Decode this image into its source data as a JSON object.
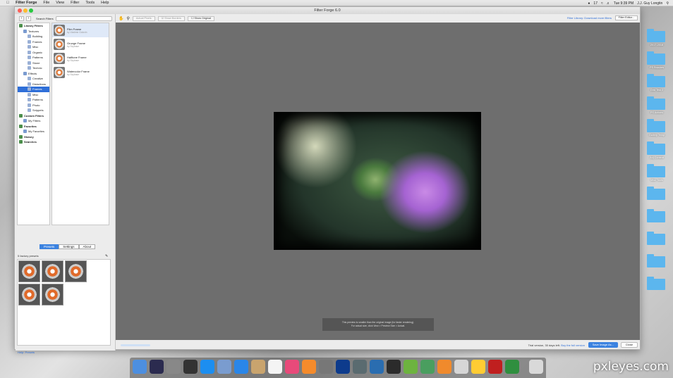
{
  "menubar": {
    "apple": "",
    "app_name": "Filter Forge",
    "items": [
      "File",
      "View",
      "Filter",
      "Tools",
      "Help"
    ],
    "time": "Tue 9:39 PM",
    "user": "J.J. Guy Longtin",
    "battery_badge": "17"
  },
  "window": {
    "title": "Filter Forge 6.0",
    "search_label": "Search Filters"
  },
  "tree": [
    {
      "label": "Library Filters",
      "level": 0,
      "bold": true
    },
    {
      "label": "Textures",
      "level": 1
    },
    {
      "label": "Building",
      "level": 2
    },
    {
      "label": "Frames",
      "level": 2
    },
    {
      "label": "Misc",
      "level": 2
    },
    {
      "label": "Organic",
      "level": 2
    },
    {
      "label": "Patterns",
      "level": 2
    },
    {
      "label": "Stone",
      "level": 2
    },
    {
      "label": "Technic",
      "level": 2
    },
    {
      "label": "Effects",
      "level": 1
    },
    {
      "label": "Creative",
      "level": 2
    },
    {
      "label": "Distortions",
      "level": 2
    },
    {
      "label": "Frames",
      "level": 2,
      "selected": true
    },
    {
      "label": "Misc",
      "level": 2
    },
    {
      "label": "Patterns",
      "level": 2
    },
    {
      "label": "Photo",
      "level": 2
    },
    {
      "label": "Snippets",
      "level": 2
    },
    {
      "label": "Custom Filters",
      "level": 0,
      "bold": true
    },
    {
      "label": "My Filters",
      "level": 1
    },
    {
      "label": "Favorites",
      "level": 0,
      "bold": true
    },
    {
      "label": "My Favorites",
      "level": 1
    },
    {
      "label": "History",
      "level": 0,
      "bold": true
    },
    {
      "label": "Searches",
      "level": 0,
      "bold": true
    }
  ],
  "filters": [
    {
      "name": "Film Frame",
      "author": "by Vladimir Golovin",
      "selected": true
    },
    {
      "name": "Grunge Frame",
      "author": "by Skybase"
    },
    {
      "name": "Halftone Frame",
      "author": "by Skybase"
    },
    {
      "name": "Watercolor Frame",
      "author": "by Skybase"
    }
  ],
  "tabs": [
    "Presets",
    "Settings",
    "About"
  ],
  "presets": {
    "label": "5 factory presets",
    "count": 5
  },
  "help_presets": "Help: Presets",
  "toolbar": {
    "actual_pixels": "Actual Pixels",
    "show_grid": "Show Borders",
    "show_original": "Show Original",
    "library_link": "Filter Library: Download more filters",
    "filter_editor": "Filter Editor..."
  },
  "notice": {
    "line1": "This preview is smaller than the original image (for faster rendering).",
    "line2": "For actual size, click View > Preview Size > Actual."
  },
  "status": {
    "trial": "Trial version, 30 days left.",
    "buy": "Buy the full version",
    "save": "Save Image As...",
    "close": "Close"
  },
  "desktop_labels": [
    "2017-2018",
    "PS Brushes",
    "Grid Test 2",
    "PS Actions",
    "Gallery Temp",
    "Adj Content",
    "Misc Tools",
    "",
    "",
    "",
    "",
    ""
  ],
  "watermark": "pxleyes.com"
}
